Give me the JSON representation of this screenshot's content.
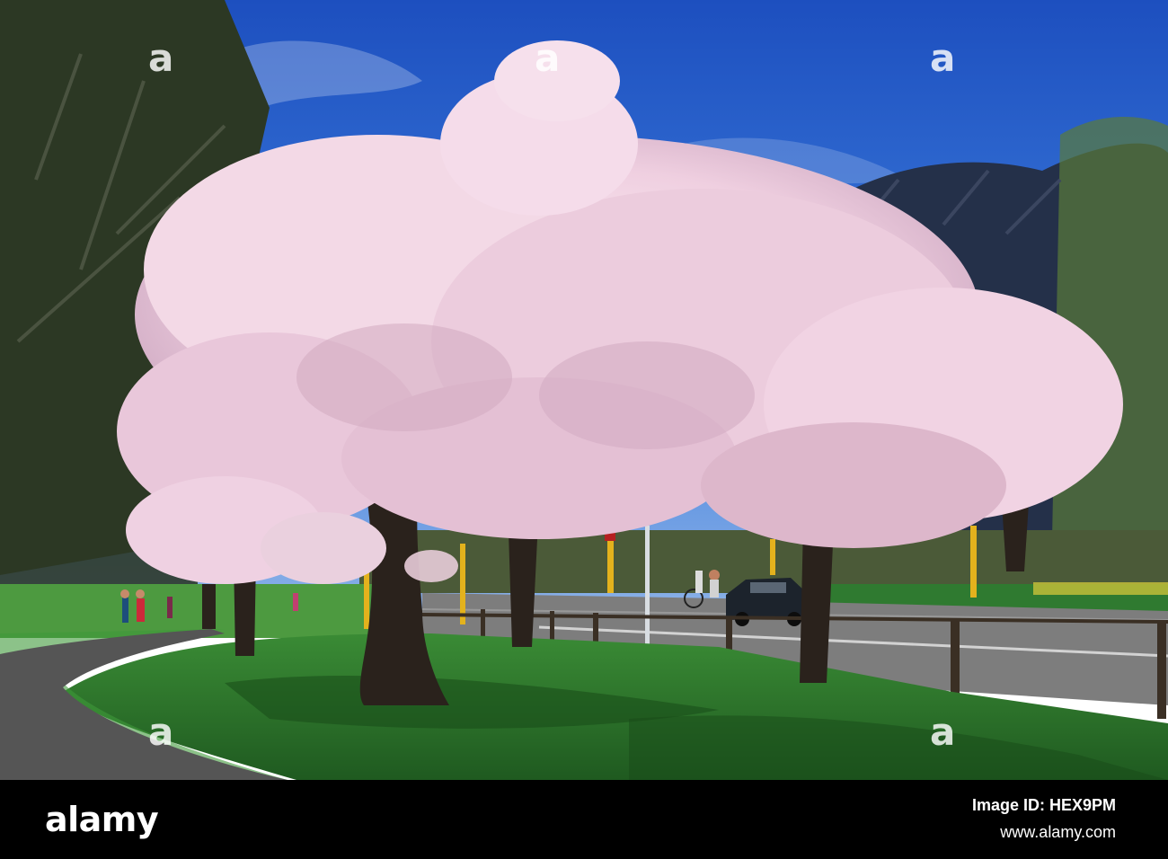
{
  "footer": {
    "brand": "alamy",
    "image_id_label": "Image ID: HEX9PM",
    "website": "www.alamy.com"
  },
  "watermarks": [
    "a",
    "a",
    "a",
    "a",
    "a"
  ],
  "colors": {
    "sky": "#2a67d0",
    "blossom": "#f1d6e4",
    "grass": "#2d7a2d",
    "road": "#8a8a8a",
    "footer": "#000000"
  }
}
